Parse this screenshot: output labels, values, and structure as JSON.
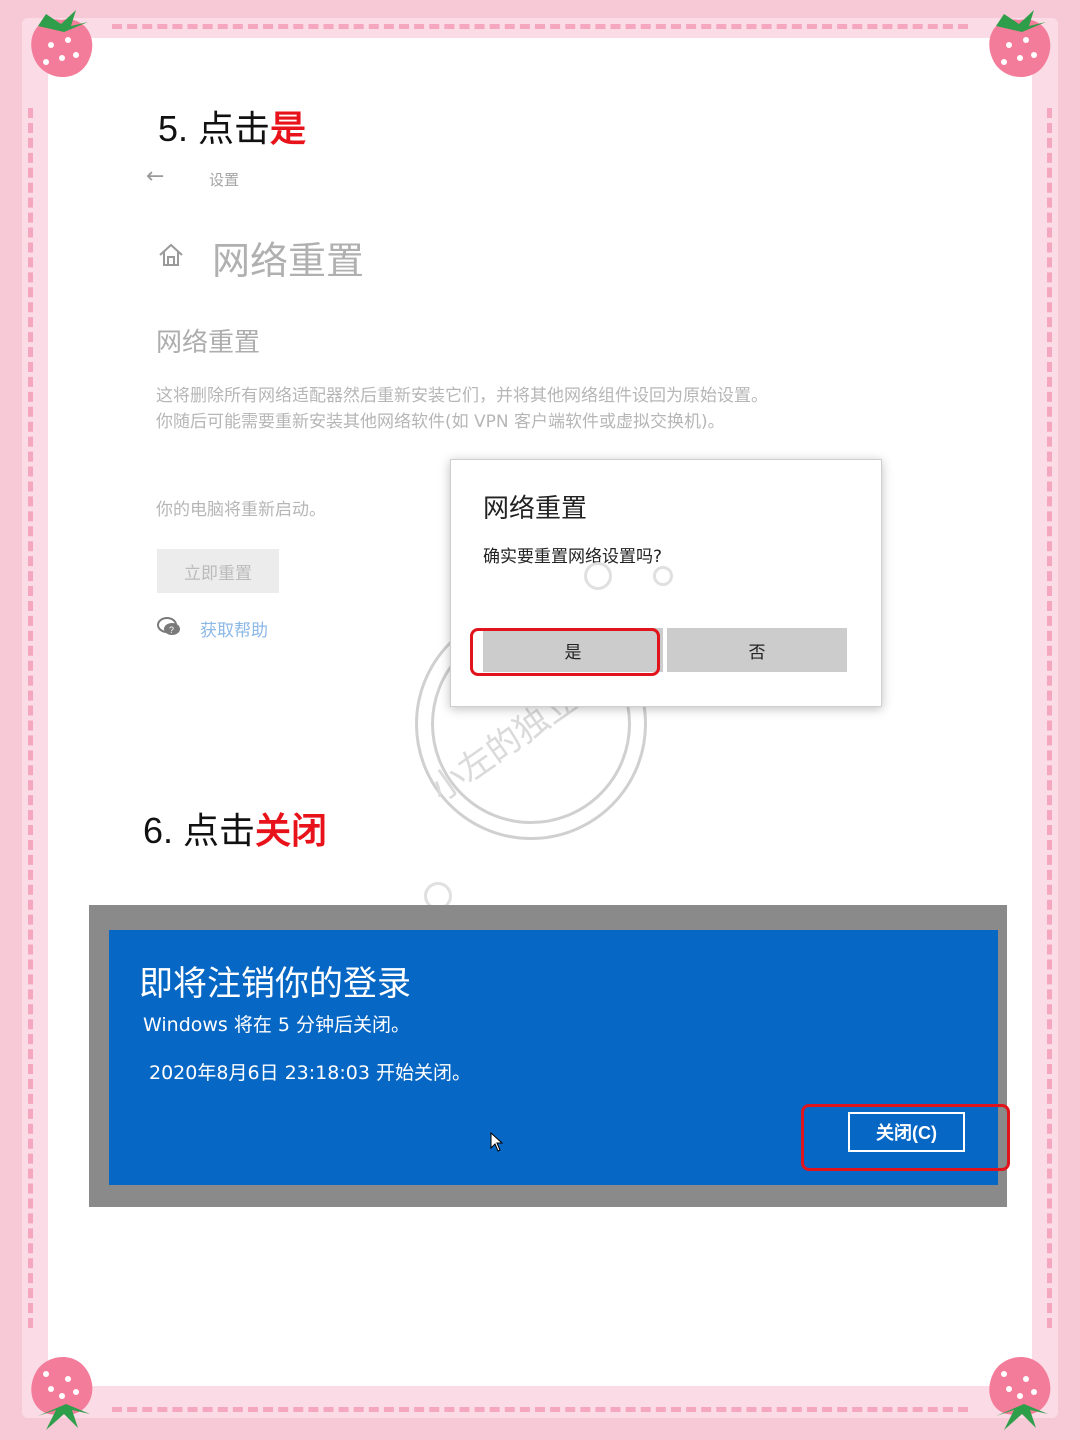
{
  "step5": {
    "prefix": "5. 点击",
    "highlight": "是"
  },
  "step6": {
    "prefix": "6. 点击",
    "highlight": "关闭"
  },
  "settings": {
    "breadcrumb": "设置",
    "page_title": "网络重置",
    "section_title": "网络重置",
    "description": "这将删除所有网络适配器然后重新安装它们，并将其他网络组件设回为原始设置。你随后可能需要重新安装其他网络软件(如 VPN 客户端软件或虚拟交换机)。",
    "restart_note": "你的电脑将重新启动。",
    "reset_button": "立即重置",
    "help_link": "获取帮助"
  },
  "dialog": {
    "title": "网络重置",
    "message": "确实要重置网络设置吗?",
    "yes": "是",
    "no": "否"
  },
  "logoff": {
    "title": "即将注销你的登录",
    "subtitle": "Windows 将在 5 分钟后关闭。",
    "time": "2020年8月6日 23:18:03 开始关闭。",
    "close_button": "关闭(C)"
  },
  "watermark": "小左的独立日记",
  "colors": {
    "highlight": "#e8121a",
    "frame_pink": "#f7c9d6",
    "logoff_blue": "#0767c4",
    "annotation_red": "#e0141c"
  }
}
